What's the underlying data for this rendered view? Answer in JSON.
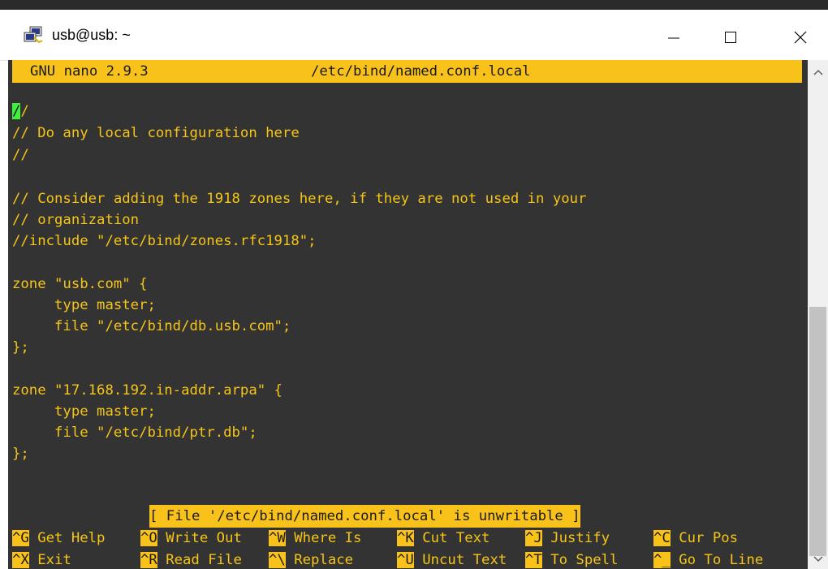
{
  "window": {
    "title": "usb@usb: ~",
    "icon": "putty-icon",
    "buttons": {
      "minimize": "minimize-icon",
      "maximize": "maximize-icon",
      "close": "close-icon"
    }
  },
  "nano": {
    "version": "GNU nano 2.9.3",
    "filename": "/etc/bind/named.conf.local",
    "cursor_char": "/",
    "first_line_rest": "/",
    "lines": [
      "// Do any local configuration here",
      "//",
      "",
      "// Consider adding the 1918 zones here, if they are not used in your",
      "// organization",
      "//include \"/etc/bind/zones.rfc1918\";",
      "",
      "zone \"usb.com\" {",
      "     type master;",
      "     file \"/etc/bind/db.usb.com\";",
      "};",
      "",
      "zone \"17.168.192.in-addr.arpa\" {",
      "     type master;",
      "     file \"/etc/bind/ptr.db\";",
      "};"
    ],
    "status": "[ File '/etc/bind/named.conf.local' is unwritable ]",
    "shortcuts_row1": [
      {
        "key": "^G",
        "label": "Get Help"
      },
      {
        "key": "^O",
        "label": "Write Out"
      },
      {
        "key": "^W",
        "label": "Where Is"
      },
      {
        "key": "^K",
        "label": "Cut Text"
      },
      {
        "key": "^J",
        "label": "Justify"
      },
      {
        "key": "^C",
        "label": "Cur Pos"
      }
    ],
    "shortcuts_row2": [
      {
        "key": "^X",
        "label": "Exit"
      },
      {
        "key": "^R",
        "label": "Read File"
      },
      {
        "key": "^\\",
        "label": "Replace"
      },
      {
        "key": "^U",
        "label": "Uncut Text"
      },
      {
        "key": "^T",
        "label": "To Spell"
      },
      {
        "key": "^_",
        "label": "Go To Line"
      }
    ]
  },
  "colors": {
    "terminal_bg": "#333333",
    "text": "#f5c518",
    "highlight": "#f9c21b",
    "cursor": "#3df23d"
  },
  "scrollbar": {
    "up_icon": "chevron-up-icon",
    "down_icon": "chevron-down-icon"
  }
}
